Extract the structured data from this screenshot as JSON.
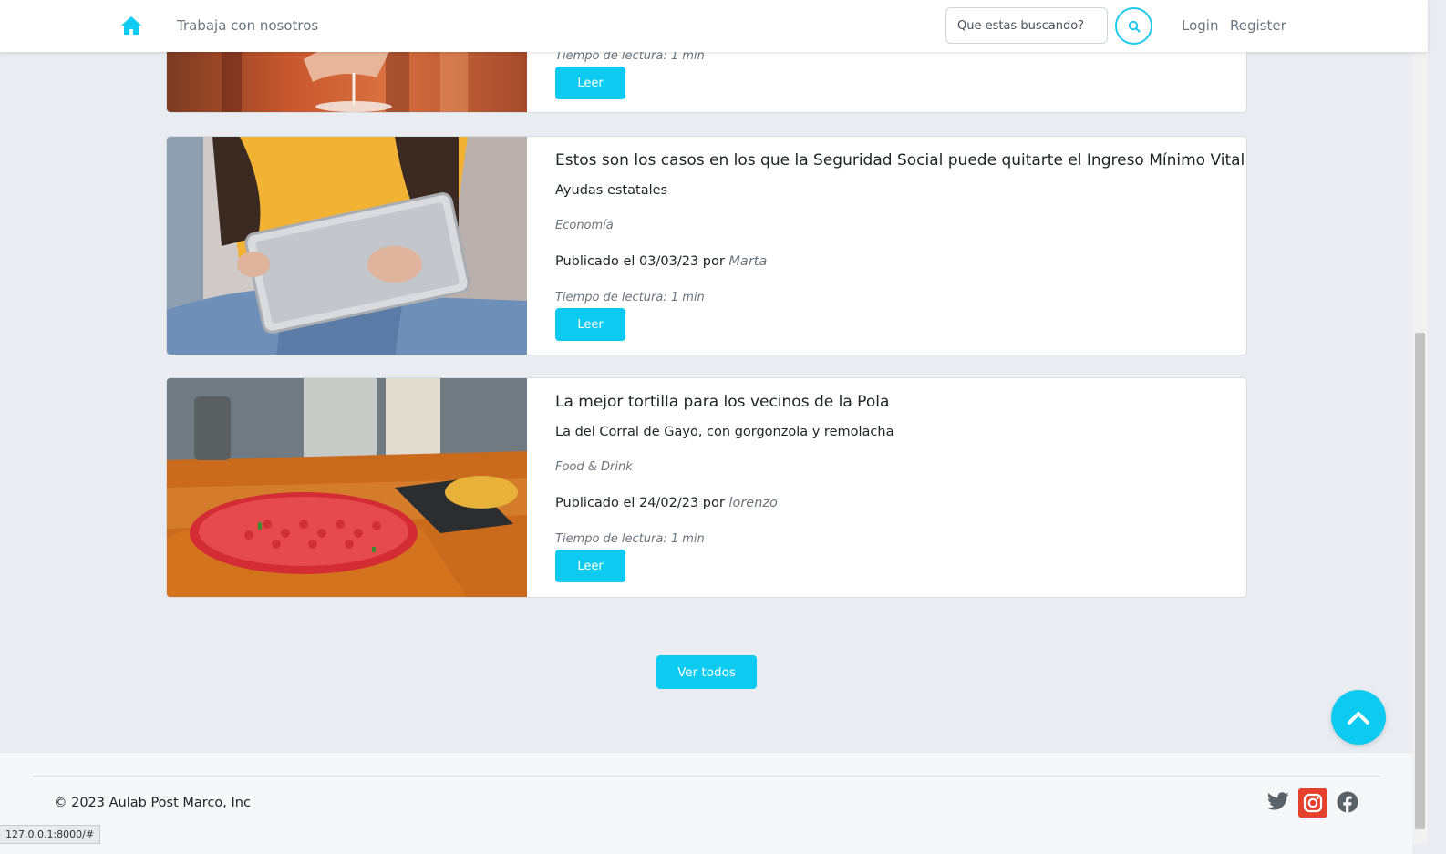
{
  "navbar": {
    "home_icon": "home-icon",
    "work_link": "Trabaja con nosotros",
    "search_placeholder": "Que estas buscando?",
    "search_icon": "search-icon",
    "login": "Login",
    "register": "Register"
  },
  "articles": [
    {
      "reading_time": "Tiempo de lectura: 1 min",
      "read_label": "Leer"
    },
    {
      "title": "Estos son los casos en los que la Seguridad Social puede quitarte el Ingreso Mínimo Vital",
      "subtitle": "Ayudas estatales",
      "category": "Economía",
      "published_prefix": "Publicado el 03/03/23 por",
      "author": "Marta",
      "reading_time": "Tiempo de lectura: 1 min",
      "read_label": "Leer"
    },
    {
      "title": "La mejor tortilla para los vecinos de la Pola",
      "subtitle": "La del Corral de Gayo, con gorgonzola y remolacha",
      "category": "Food & Drink",
      "published_prefix": "Publicado el 24/02/23 por",
      "author": "lorenzo",
      "reading_time": "Tiempo de lectura: 1 min",
      "read_label": "Leer"
    }
  ],
  "view_all": "Ver todos",
  "scroll_top_icon": "chevron-up-icon",
  "footer": {
    "copyright": "© 2023 Aulab Post Marco, Inc",
    "social": [
      "twitter-icon",
      "instagram-icon",
      "facebook-icon"
    ]
  },
  "status_url": "127.0.0.1:8000/#",
  "colors": {
    "accent": "#0dcaf0",
    "background": "#e9edf2",
    "instagram": "#e4402c"
  }
}
